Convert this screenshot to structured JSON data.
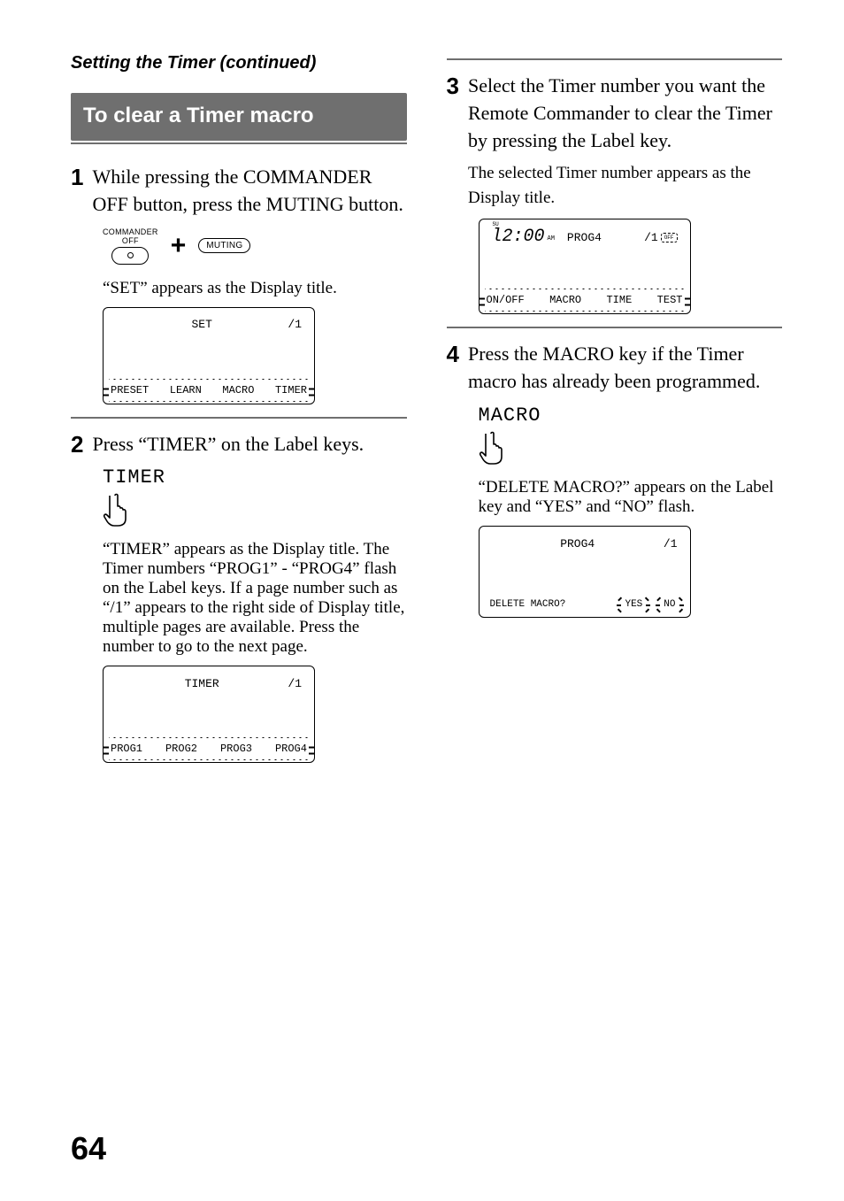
{
  "continued_header": "Setting the Timer (continued)",
  "section_title": "To clear a Timer macro",
  "left": {
    "step1": {
      "num": "1",
      "text": "While pressing the COMMANDER OFF button, press the MUTING button.",
      "commander_label_top": "COMMANDER",
      "commander_label_bottom": "OFF",
      "plus": "+",
      "muting_label": "MUTING",
      "result_text": "“SET” appears as the Display title.",
      "lcd": {
        "title_center": "SET",
        "title_right": "/1",
        "labels": [
          "PRESET",
          "LEARN",
          "MACRO",
          "TIMER"
        ]
      }
    },
    "step2": {
      "num": "2",
      "text": "Press “TIMER” on the Label keys.",
      "mono": "TIMER",
      "result_text": "“TIMER” appears as the Display title. The Timer numbers “PROG1” - “PROG4” flash on the Label keys. If a page number such as “/1” appears to the right side of Display title, multiple pages are available. Press the number to go to the next page.",
      "lcd": {
        "title_center": "TIMER",
        "title_right": "/1",
        "labels": [
          "PROG1",
          "PROG2",
          "PROG3",
          "PROG4"
        ]
      }
    }
  },
  "right": {
    "step3": {
      "num": "3",
      "text": "Select the Timer number you want the Remote Commander to clear the Timer by pressing the Label key.",
      "result_text": "The selected Timer number appears as the Display title.",
      "lcd": {
        "clock_su": "SU",
        "clock_time": "l2:00",
        "clock_am": "AM",
        "title_center": "PROG4",
        "title_right_page": "/1",
        "title_right_off": "OFF",
        "labels": [
          "ON/OFF",
          "MACRO",
          "TIME",
          "TEST"
        ]
      }
    },
    "step4": {
      "num": "4",
      "text": "Press the MACRO key if the Timer macro has already been programmed.",
      "mono": "MACRO",
      "result_text": "“DELETE MACRO?” appears on the Label key and “YES” and “NO” flash.",
      "lcd": {
        "title_center": "PROG4",
        "title_right": "/1",
        "bottom_left": "DELETE MACRO?",
        "bottom_opts": [
          "YES",
          "NO"
        ]
      }
    }
  },
  "page_number": "64"
}
